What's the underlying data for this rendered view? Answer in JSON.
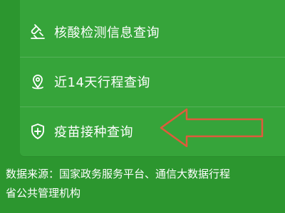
{
  "menu": {
    "items": [
      {
        "label": "核酸检测信息查询",
        "icon": "test-tube-icon"
      },
      {
        "label": "近14天行程查询",
        "icon": "location-pin-icon"
      },
      {
        "label": "疫苗接种查询",
        "icon": "shield-plus-icon"
      }
    ]
  },
  "annotation": {
    "type": "arrow",
    "color": "#e05a3c",
    "points_to": "疫苗接种查询"
  },
  "footer": {
    "source_line1": "数据来源：国家政务服务平台、通信大数据行程",
    "source_line2": "省公共管理机构"
  },
  "colors": {
    "background": "#2c962f",
    "panel": "#36a43a",
    "text": "#ffffff",
    "annotation": "#e05a3c"
  }
}
